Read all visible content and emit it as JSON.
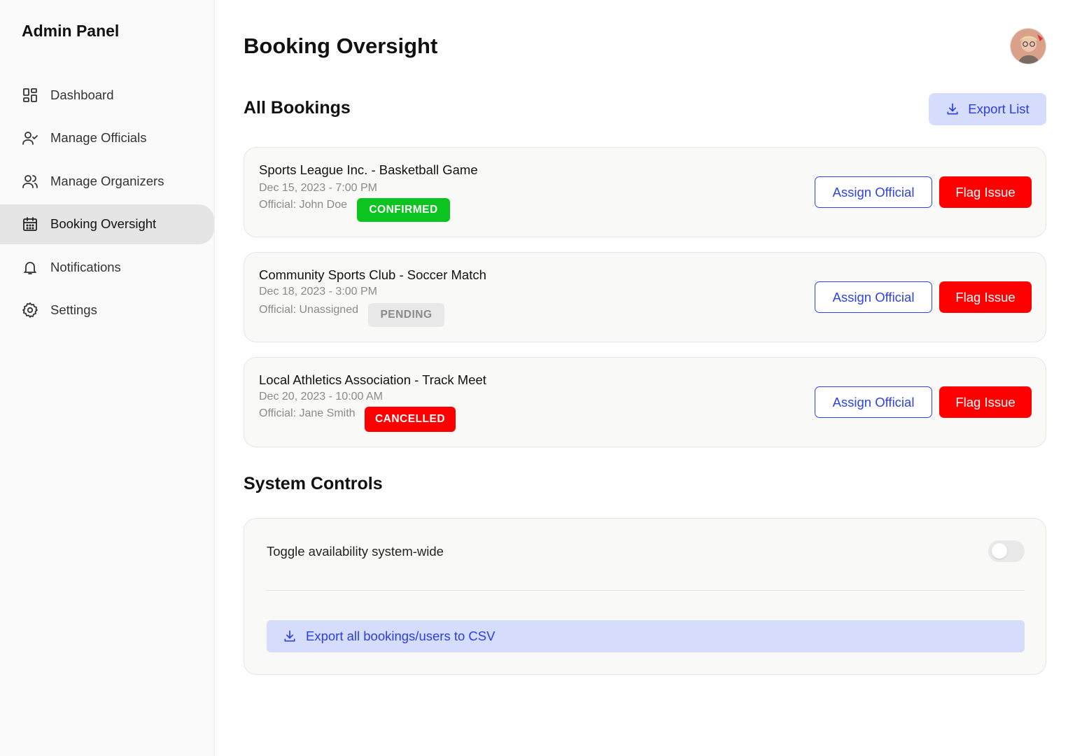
{
  "sidebar": {
    "brand": "Admin Panel",
    "items": [
      {
        "label": "Dashboard",
        "icon": "dashboard-icon",
        "active": false
      },
      {
        "label": "Manage Officials",
        "icon": "user-check-icon",
        "active": false
      },
      {
        "label": "Manage Organizers",
        "icon": "users-icon",
        "active": false
      },
      {
        "label": "Booking Oversight",
        "icon": "calendar-icon",
        "active": true
      },
      {
        "label": "Notifications",
        "icon": "bell-icon",
        "active": false
      },
      {
        "label": "Settings",
        "icon": "gear-icon",
        "active": false
      }
    ]
  },
  "header": {
    "title": "Booking Oversight",
    "avatar": "user-avatar"
  },
  "bookings_section": {
    "title": "All Bookings",
    "export_label": "Export List",
    "bookings": [
      {
        "title": "Sports League Inc. - Basketball Game",
        "date": "Dec 15, 2023 - 7:00 PM",
        "official": "Official: John Doe",
        "status": "CONFIRMED",
        "assign_label": "Assign Official",
        "flag_label": "Flag Issue"
      },
      {
        "title": "Community Sports Club - Soccer Match",
        "date": "Dec 18, 2023 - 3:00 PM",
        "official": "Official: Unassigned",
        "status": "PENDING",
        "assign_label": "Assign Official",
        "flag_label": "Flag Issue"
      },
      {
        "title": "Local Athletics Association - Track Meet",
        "date": "Dec 20, 2023 - 10:00 AM",
        "official": "Official: Jane Smith",
        "status": "CANCELLED",
        "assign_label": "Assign Official",
        "flag_label": "Flag Issue"
      }
    ]
  },
  "controls_section": {
    "title": "System Controls",
    "toggle_label": "Toggle availability system-wide",
    "toggle_on": false,
    "export_csv_label": "Export all bookings/users to CSV"
  },
  "colors": {
    "accent": "#2f43e2",
    "accent_soft": "#d6dcfb",
    "danger": "#ff0000",
    "success": "#0bc41f"
  }
}
